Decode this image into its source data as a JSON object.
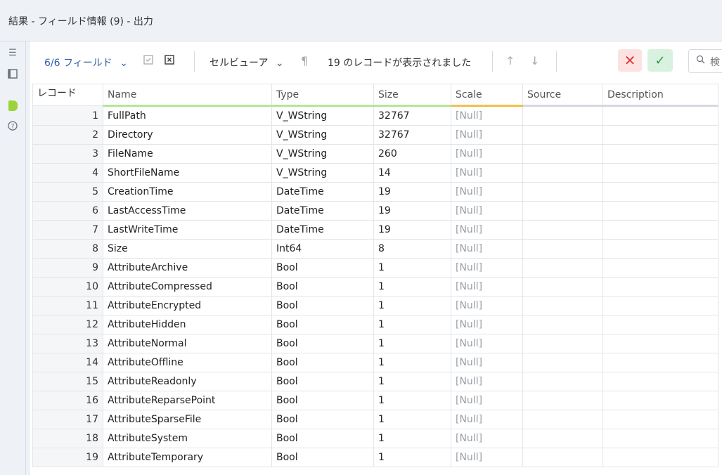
{
  "window": {
    "title": "結果 - フィールド情報 (9) - 出力"
  },
  "toolbar": {
    "fields_label": "6/6 フィールド",
    "viewer_label": "セルビューア",
    "record_count_text": "19 のレコードが表示されました",
    "search_placeholder": "検"
  },
  "grid": {
    "headers": {
      "record": "レコード",
      "name": "Name",
      "type": "Type",
      "size": "Size",
      "scale": "Scale",
      "source": "Source",
      "description": "Description"
    },
    "rows": [
      {
        "rec": "1",
        "name": "FullPath",
        "type": "V_WString",
        "size": "32767",
        "scale": "[Null]",
        "source": "",
        "description": ""
      },
      {
        "rec": "2",
        "name": "Directory",
        "type": "V_WString",
        "size": "32767",
        "scale": "[Null]",
        "source": "",
        "description": ""
      },
      {
        "rec": "3",
        "name": "FileName",
        "type": "V_WString",
        "size": "260",
        "scale": "[Null]",
        "source": "",
        "description": ""
      },
      {
        "rec": "4",
        "name": "ShortFileName",
        "type": "V_WString",
        "size": "14",
        "scale": "[Null]",
        "source": "",
        "description": ""
      },
      {
        "rec": "5",
        "name": "CreationTime",
        "type": "DateTime",
        "size": "19",
        "scale": "[Null]",
        "source": "",
        "description": ""
      },
      {
        "rec": "6",
        "name": "LastAccessTime",
        "type": "DateTime",
        "size": "19",
        "scale": "[Null]",
        "source": "",
        "description": ""
      },
      {
        "rec": "7",
        "name": "LastWriteTime",
        "type": "DateTime",
        "size": "19",
        "scale": "[Null]",
        "source": "",
        "description": ""
      },
      {
        "rec": "8",
        "name": "Size",
        "type": "Int64",
        "size": "8",
        "scale": "[Null]",
        "source": "",
        "description": ""
      },
      {
        "rec": "9",
        "name": "AttributeArchive",
        "type": "Bool",
        "size": "1",
        "scale": "[Null]",
        "source": "",
        "description": ""
      },
      {
        "rec": "10",
        "name": "AttributeCompressed",
        "type": "Bool",
        "size": "1",
        "scale": "[Null]",
        "source": "",
        "description": ""
      },
      {
        "rec": "11",
        "name": "AttributeEncrypted",
        "type": "Bool",
        "size": "1",
        "scale": "[Null]",
        "source": "",
        "description": ""
      },
      {
        "rec": "12",
        "name": "AttributeHidden",
        "type": "Bool",
        "size": "1",
        "scale": "[Null]",
        "source": "",
        "description": ""
      },
      {
        "rec": "13",
        "name": "AttributeNormal",
        "type": "Bool",
        "size": "1",
        "scale": "[Null]",
        "source": "",
        "description": ""
      },
      {
        "rec": "14",
        "name": "AttributeOffline",
        "type": "Bool",
        "size": "1",
        "scale": "[Null]",
        "source": "",
        "description": ""
      },
      {
        "rec": "15",
        "name": "AttributeReadonly",
        "type": "Bool",
        "size": "1",
        "scale": "[Null]",
        "source": "",
        "description": ""
      },
      {
        "rec": "16",
        "name": "AttributeReparsePoint",
        "type": "Bool",
        "size": "1",
        "scale": "[Null]",
        "source": "",
        "description": ""
      },
      {
        "rec": "17",
        "name": "AttributeSparseFile",
        "type": "Bool",
        "size": "1",
        "scale": "[Null]",
        "source": "",
        "description": ""
      },
      {
        "rec": "18",
        "name": "AttributeSystem",
        "type": "Bool",
        "size": "1",
        "scale": "[Null]",
        "source": "",
        "description": ""
      },
      {
        "rec": "19",
        "name": "AttributeTemporary",
        "type": "Bool",
        "size": "1",
        "scale": "[Null]",
        "source": "",
        "description": ""
      }
    ]
  }
}
